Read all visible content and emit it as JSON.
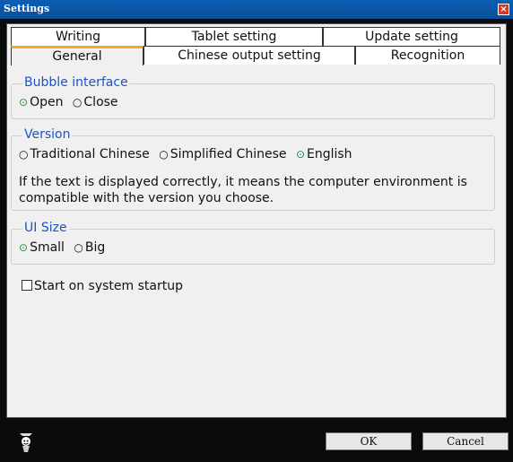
{
  "window": {
    "title": "Settings"
  },
  "tabs": {
    "row1": [
      "Writing",
      "Tablet setting",
      "Update setting"
    ],
    "row2": [
      "General",
      "Chinese output setting",
      "Recognition"
    ],
    "active": "General"
  },
  "general": {
    "bubble_interface": {
      "legend": "Bubble interface",
      "options": [
        "Open",
        "Close"
      ],
      "selected": "Open"
    },
    "version": {
      "legend": "Version",
      "options": [
        "Traditional Chinese",
        "Simplified Chinese",
        "English"
      ],
      "selected": "English",
      "note": "If the text is displayed correctly, it means the computer environment is compatible with the version you choose."
    },
    "ui_size": {
      "legend": "UI Size",
      "options": [
        "Small",
        "Big"
      ],
      "selected": "Small"
    },
    "startup": {
      "label": "Start on system startup",
      "checked": false
    }
  },
  "buttons": {
    "ok": "OK",
    "cancel": "Cancel"
  },
  "icons": {
    "close": "close-icon",
    "logo": "app-logo-icon"
  }
}
